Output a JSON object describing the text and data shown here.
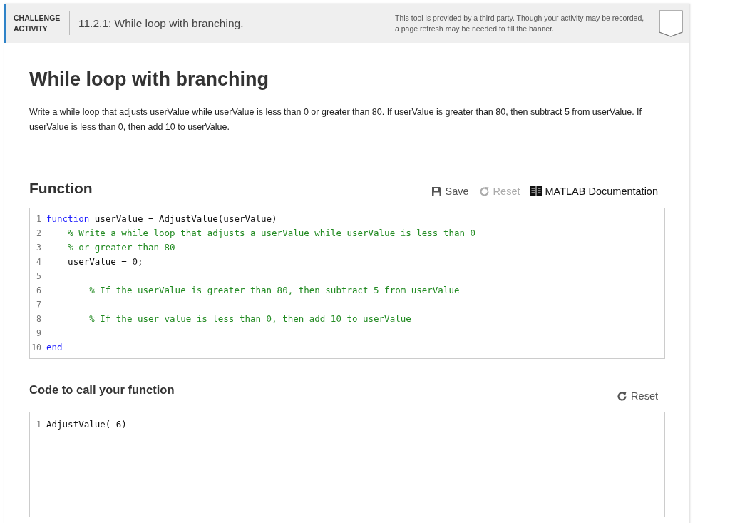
{
  "header": {
    "badge_lines": [
      "CHALLENGE",
      "ACTIVITY"
    ],
    "title": "11.2.1: While loop with branching.",
    "notice": "This tool is provided by a third party. Though your activity may be recorded, a page refresh may be needed to fill the banner."
  },
  "heading": "While loop with branching",
  "instructions": "Write a while loop that adjusts userValue while userValue is less than 0 or greater than 80. If userValue is greater than 80, then subtract 5 from userValue. If userValue is less than 0, then add 10 to userValue.",
  "function_section": {
    "title": "Function",
    "actions": [
      {
        "kind": "save",
        "label": "Save",
        "disabled": false
      },
      {
        "kind": "reset",
        "label": "Reset",
        "disabled": true
      },
      {
        "kind": "docs",
        "label": "MATLAB Documentation"
      }
    ],
    "lines": [
      {
        "number": "1",
        "tokens": [
          {
            "kind": "keyword",
            "text": "function"
          },
          {
            "kind": "plain",
            "text": " userValue = AdjustValue(userValue)"
          }
        ]
      },
      {
        "number": "2",
        "tokens": [
          {
            "kind": "comment",
            "text": "    % Write a while loop that adjusts a userValue while userValue is less than 0"
          }
        ]
      },
      {
        "number": "3",
        "tokens": [
          {
            "kind": "comment",
            "text": "    % or greater than 80"
          }
        ]
      },
      {
        "number": "4",
        "tokens": [
          {
            "kind": "plain",
            "text": "    userValue = 0;"
          }
        ]
      },
      {
        "number": "5"
      },
      {
        "number": "6",
        "tokens": [
          {
            "kind": "comment",
            "text": "        % If the userValue is greater than 80, then subtract 5 from userValue"
          }
        ]
      },
      {
        "number": "7"
      },
      {
        "number": "8",
        "tokens": [
          {
            "kind": "comment",
            "text": "        % If the user value is less than 0, then add 10 to userValue"
          }
        ]
      },
      {
        "number": "9"
      },
      {
        "number": "10",
        "tokens": [
          {
            "kind": "keyword",
            "text": "end"
          }
        ]
      }
    ]
  },
  "call_section": {
    "title": "Code to call your function",
    "actions": [
      {
        "kind": "reset",
        "label": "Reset",
        "disabled": false
      }
    ],
    "lines": [
      {
        "number": "1",
        "tokens": [
          {
            "kind": "plain",
            "text": "AdjustValue(-6)"
          }
        ]
      }
    ]
  }
}
